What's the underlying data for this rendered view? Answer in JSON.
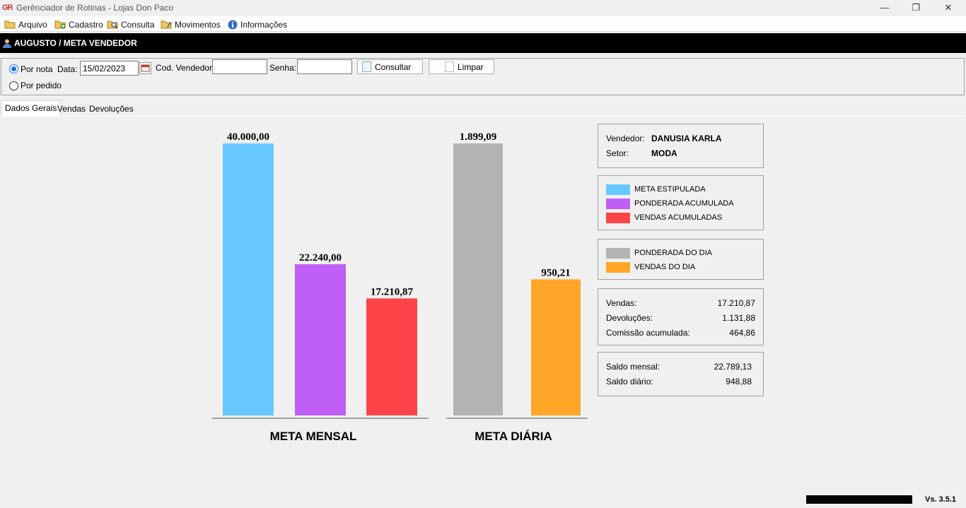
{
  "window": {
    "logo_text": "GR",
    "title": "Gerênciador de Rotinas - Lojas Don Paco",
    "minimize": "—",
    "restore": "❐",
    "close": "✕"
  },
  "menu": {
    "items": [
      {
        "label": "Arquivo",
        "icon": "folder-icon"
      },
      {
        "label": "Cadastro",
        "icon": "add-record-icon"
      },
      {
        "label": "Consulta",
        "icon": "search-folder-icon"
      },
      {
        "label": "Movimentos",
        "icon": "edit-folder-icon"
      },
      {
        "label": "Informações",
        "icon": "info-icon"
      }
    ]
  },
  "header": {
    "title": "AUGUSTO / META VENDEDOR",
    "icon": "user-icon"
  },
  "filters": {
    "radio_por_nota": "Por nota",
    "radio_por_pedido": "Por pedido",
    "selected": "Por nota",
    "data_label": "Data:",
    "data_value": "15/02/2023",
    "cod_vendedor_label": "Cod. Vendedor:",
    "cod_vendedor_value": "",
    "senha_label": "Senha:",
    "senha_value": "",
    "consultar_label": "Consultar",
    "limpar_label": "Limpar"
  },
  "tabs": [
    {
      "label": "Dados Gerais",
      "active": true
    },
    {
      "label": "Vendas",
      "active": false
    },
    {
      "label": "Devoluções",
      "active": false
    }
  ],
  "chart_data": {
    "type": "bar",
    "groups": [
      {
        "title": "META MENSAL",
        "bars": [
          {
            "name": "META ESTIPULADA",
            "value": 40000.0,
            "label": "40.000,00",
            "color": "#66c8ff"
          },
          {
            "name": "PONDERADA ACUMULADA",
            "value": 22240.0,
            "label": "22.240,00",
            "color": "#bf5ff5"
          },
          {
            "name": "VENDAS ACUMULADAS",
            "value": 17210.87,
            "label": "17.210,87",
            "color": "#ff4449"
          }
        ]
      },
      {
        "title": "META DIÁRIA",
        "bars": [
          {
            "name": "PONDERADA DO DIA",
            "value": 1899.09,
            "label": "1.899,09",
            "color": "#b3b3b3"
          },
          {
            "name": "VENDAS DO DIA",
            "value": 950.21,
            "label": "950,21",
            "color": "#ffa628"
          }
        ]
      }
    ],
    "grid": false
  },
  "seller": {
    "vendedor_label": "Vendedor:",
    "vendedor_value": "DANUSIA KARLA",
    "setor_label": "Setor:",
    "setor_value": "MODA"
  },
  "legend_mensal": [
    {
      "label": "META ESTIPULADA",
      "color": "#66c8ff"
    },
    {
      "label": "PONDERADA ACUMULADA",
      "color": "#bf5ff5"
    },
    {
      "label": "VENDAS ACUMULADAS",
      "color": "#ff4449"
    }
  ],
  "legend_diaria": [
    {
      "label": "PONDERADA DO DIA",
      "color": "#b3b3b3"
    },
    {
      "label": "VENDAS DO DIA",
      "color": "#ffa628"
    }
  ],
  "totals": {
    "vendas_label": "Vendas:",
    "vendas_value": "17.210,87",
    "devolucoes_label": "Devoluções:",
    "devolucoes_value": "1.131,88",
    "comissao_label": "Comissão acumulada:",
    "comissao_value": "464,86"
  },
  "saldo": {
    "mensal_label": "Saldo mensal:",
    "mensal_value": "22.789,13",
    "diario_label": "Saldo diário:",
    "diario_value": "948,88"
  },
  "footer": {
    "version": "Vs. 3.5.1"
  }
}
